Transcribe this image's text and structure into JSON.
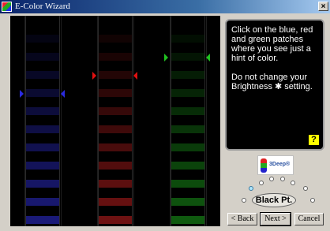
{
  "window": {
    "title": "E-Color Wizard",
    "close_label": "×"
  },
  "instructions": {
    "line1": "Click on the blue, red and green patches where you see just a hint of color.",
    "line2": "Do not change your Brightness ✱ setting.",
    "help_label": "?"
  },
  "logo": {
    "text": "3Deep®"
  },
  "black_point": {
    "label": "Black Pt."
  },
  "buttons": {
    "back": "< Back",
    "next": "Next >",
    "cancel": "Cancel"
  },
  "colors": {
    "blue": "#1a1a78",
    "red": "#6e1212",
    "green": "#0f5a0f",
    "marker_green": "#20c020",
    "marker_red": "#e01010",
    "marker_blue": "#2a2ae0"
  }
}
